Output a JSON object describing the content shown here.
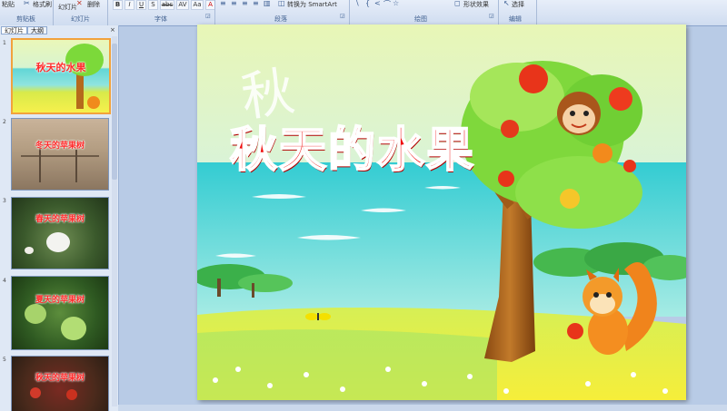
{
  "ribbon": {
    "top_left_label": "粘贴",
    "format_painter": "格式刷",
    "new_slide": "幻灯片",
    "delete": "删除",
    "convert_smartart": "转换为 SmartArt",
    "shape_effects": "形状效果",
    "select": "选择",
    "groups": [
      "剪贴板",
      "幻灯片",
      "字体",
      "段落",
      "绘图",
      "编辑"
    ],
    "format_buttons": [
      "B",
      "I",
      "U",
      "S",
      "abc",
      "AV",
      "Aa",
      "A"
    ]
  },
  "panel": {
    "tabs": [
      "幻灯片",
      "大纲"
    ],
    "close": "×",
    "slides": [
      {
        "num": "1",
        "title": "秋天的水果"
      },
      {
        "num": "2",
        "title": "冬天的苹果树"
      },
      {
        "num": "3",
        "title": "春天的苹果树"
      },
      {
        "num": "4",
        "title": "夏天的苹果树"
      },
      {
        "num": "5",
        "title": "秋天的苹果树"
      }
    ]
  },
  "slide": {
    "title": "秋天的水果",
    "deco_char": "秋"
  },
  "colors": {
    "title_red": "#ef0b0b",
    "sky": "#dff3c8",
    "sea": "#3fd0d6",
    "grass": "#f4ec3c"
  }
}
